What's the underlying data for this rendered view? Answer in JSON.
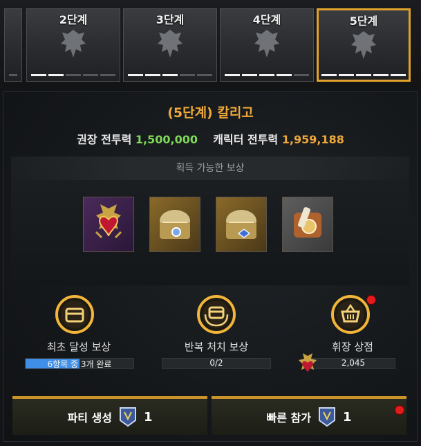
{
  "stages": [
    {
      "label": "",
      "filled": 0,
      "total": 1,
      "selected": false
    },
    {
      "label": "2단계",
      "filled": 2,
      "total": 5,
      "selected": false
    },
    {
      "label": "3단계",
      "filled": 3,
      "total": 5,
      "selected": false
    },
    {
      "label": "4단계",
      "filled": 4,
      "total": 5,
      "selected": false
    },
    {
      "label": "5단계",
      "filled": 5,
      "total": 5,
      "selected": true
    }
  ],
  "boss": {
    "title": "(5단계) 칼리고"
  },
  "power": {
    "recommended_label": "권장 전투력",
    "recommended_value": "1,500,000",
    "character_label": "캐릭터 전투력",
    "character_value": "1,959,188"
  },
  "rewards": {
    "header": "획득 가능한 보상",
    "items": [
      "jewel-heart-icon",
      "treasure-chest-icon",
      "treasure-chest-blue-icon",
      "scroll-chest-icon"
    ]
  },
  "categories": {
    "first_clear": {
      "label": "최초 달성 보상",
      "progress_text": "6항목 중 3개 완료",
      "progress": 0.5
    },
    "repeat_kill": {
      "label": "반복 처치 보상",
      "progress_text": "0/2",
      "progress": 0
    },
    "badge_shop": {
      "label": "휘장 상점",
      "value": "2,045"
    }
  },
  "buttons": {
    "party_create": {
      "label": "파티 생성",
      "count": "1"
    },
    "quick_join": {
      "label": "빠른 참가",
      "count": "1"
    }
  },
  "colors": {
    "accent": "#f0a83a",
    "green": "#7ed957",
    "progress": "#3f8ee8",
    "notification": "#e21b1b"
  }
}
